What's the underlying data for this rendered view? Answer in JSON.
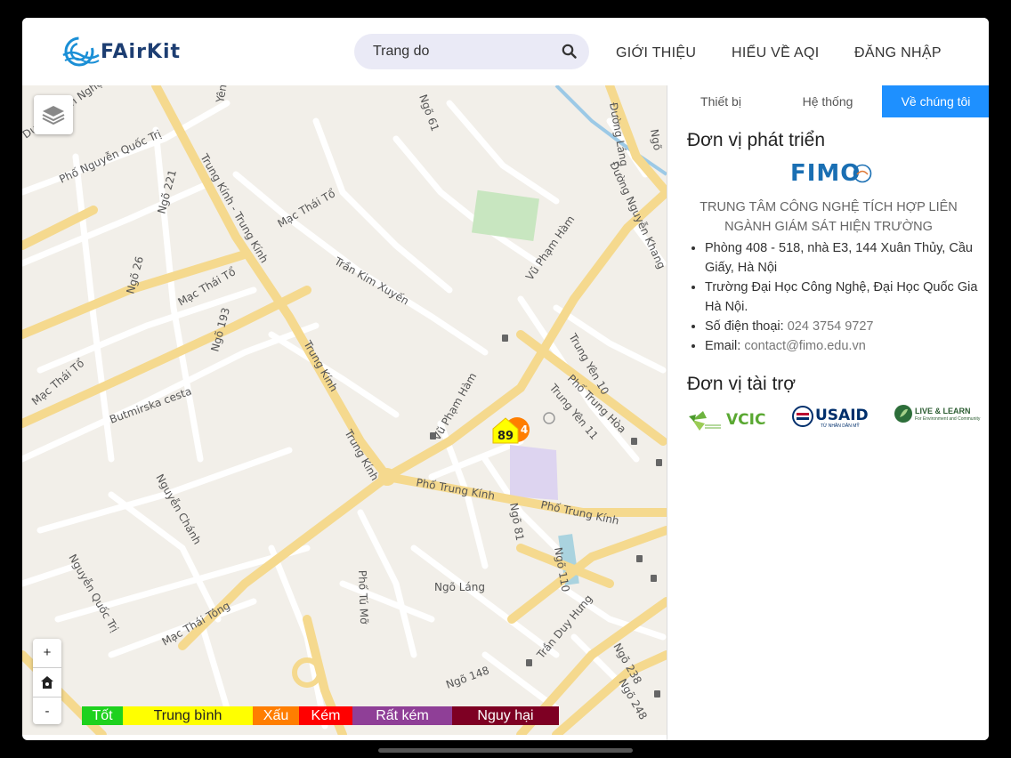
{
  "header": {
    "logo_text": "FAirKit",
    "search_value": "Trang do",
    "nav": [
      "GIỚI THIỆU",
      "HIỂU VỀ AQI",
      "ĐĂNG NHẬP"
    ]
  },
  "panel": {
    "tabs": [
      "Thiết bị",
      "Hệ thống",
      "Về chúng tôi"
    ],
    "active_tab": "Về chúng tôi",
    "developer_heading": "Đơn vị phát triển",
    "developer_logo": "FIMO",
    "org_name": "TRUNG TÂM CÔNG NGHỆ TÍCH HỢP LIÊN NGÀNH GIÁM SÁT HIỆN TRƯỜNG",
    "info": {
      "address1": "Phòng 408 - 518, nhà E3, 144 Xuân Thủy, Cầu Giấy, Hà Nội",
      "address2": "Trường Đại Học Công Nghệ, Đại Học Quốc Gia Hà Nội.",
      "phone_label": "Số điện thoại: ",
      "phone": "024 3754 9727",
      "email_label": "Email: ",
      "email": "contact@fimo.edu.vn"
    },
    "sponsor_heading": "Đơn vị tài trợ",
    "sponsors": [
      "VCIC",
      "USAID",
      "LIVE & LEARN"
    ],
    "usaid_sub": "TỪ NHÂN DÂN MỸ",
    "livelearn_sub": "For Environment and Community"
  },
  "map": {
    "zoom_in": "+",
    "zoom_out": "-",
    "marker_values": [
      "89",
      "4"
    ],
    "street_labels": [
      "Phố Nguyễn Quốc Trị",
      "Ngõ 221",
      "Trung Kính - Trung Kính",
      "Mạc Thái Tổ",
      "Ngõ 26",
      "Mạc Thái Tổ",
      "Ngõ 193",
      "Trần Kim Xuyến",
      "Vũ Phạm Hàm",
      "Mạc Thái Tổ",
      "Butmirska cesta",
      "Trung Kính",
      "Trung Kính",
      "Vũ Phạm Hàm",
      "Trung Yên 10",
      "Phố Trung Hòa",
      "Trung Yên 11",
      "Phố Trung Kính",
      "Phố Trung Kính",
      "Ngõ 81",
      "Ngõ 110",
      "Nguyễn Chánh",
      "Nguyễn Quốc Trị",
      "Ngõ Láng",
      "Phố Tú Mỡ",
      "Mạc Thái Tông",
      "Trần Duy Hưng",
      "Ngõ 148",
      "Ngõ 238",
      "Ngõ 248",
      "Đường Láng",
      "Đường Nguyễn Khang",
      "Ngõ 61",
      "Yên Hòa",
      "Dương Đình Nghệ",
      "Ngõ"
    ],
    "legend": [
      {
        "label": "Tốt",
        "color": "#1ed11e"
      },
      {
        "label": "Trung bình",
        "color": "#ffff00"
      },
      {
        "label": "Xấu",
        "color": "#ff7e00"
      },
      {
        "label": "Kém",
        "color": "#ff0000"
      },
      {
        "label": "Rất kém",
        "color": "#8f3f97"
      },
      {
        "label": "Nguy hại",
        "color": "#7e0023"
      }
    ]
  }
}
